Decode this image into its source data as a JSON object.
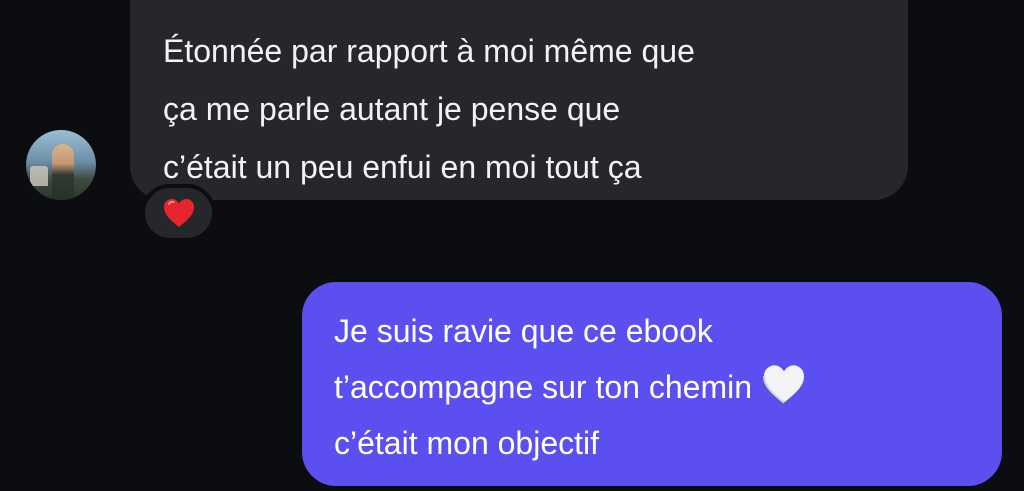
{
  "conversation": {
    "incoming": {
      "lines": [
        "Étonnée par rapport à moi même que",
        "ça me parle autant je pense que",
        "c’était un peu enfui en moi tout ça"
      ],
      "reaction_icon": "red-heart-icon",
      "bubble_color": "#26272b"
    },
    "outgoing": {
      "lines": [
        "Je suis ravie que ce ebook",
        "t’accompagne sur ton chemin",
        "c’était mon objectif"
      ],
      "emoji_icon": "white-heart-icon",
      "bubble_color": "#5b4ff0"
    },
    "background_color": "#0c0d11"
  }
}
